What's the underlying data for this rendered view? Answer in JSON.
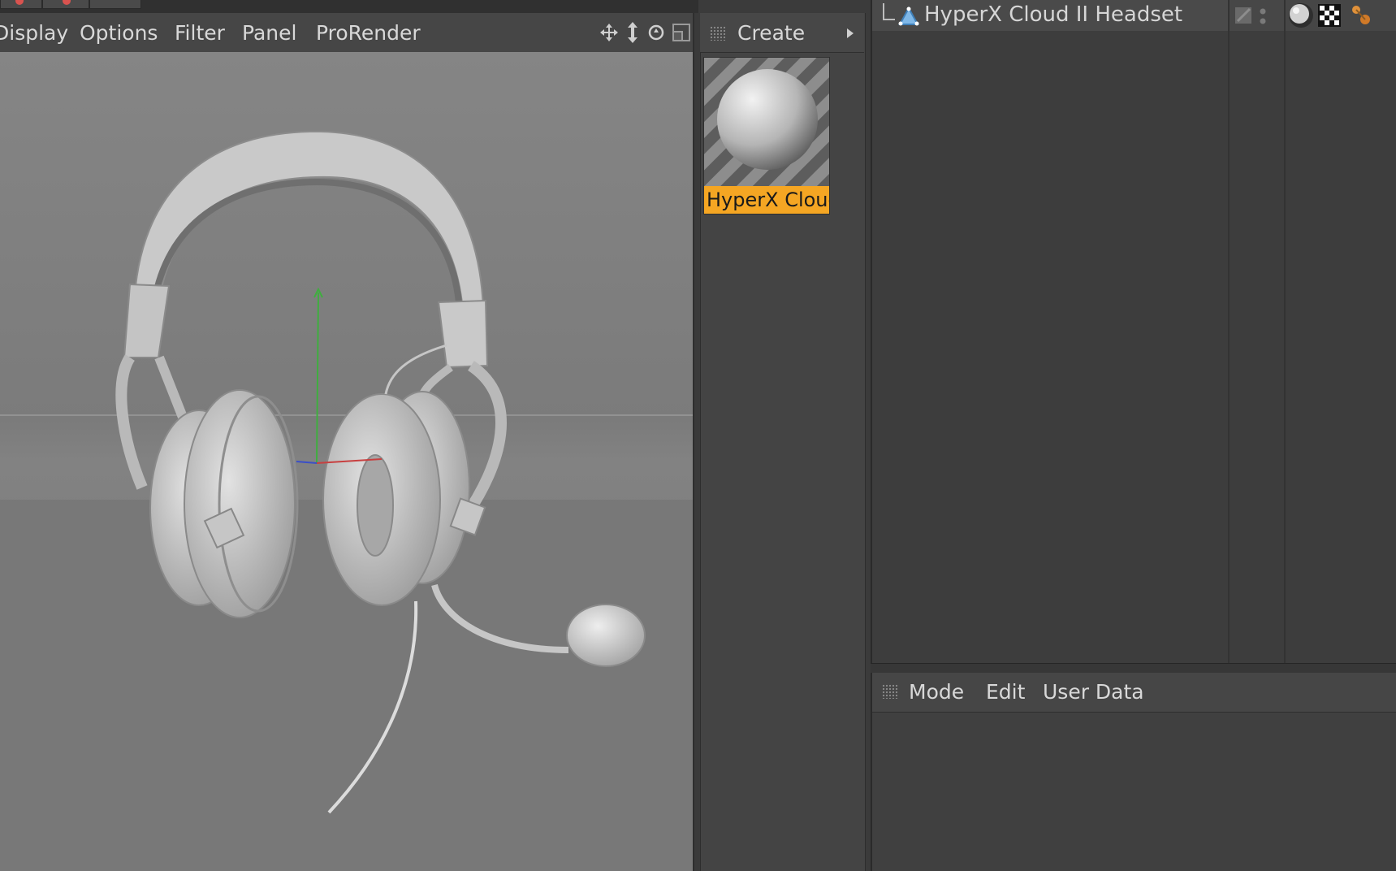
{
  "viewport_menu": {
    "items": [
      "Display",
      "Options",
      "Filter",
      "Panel",
      "ProRender"
    ],
    "nav_icons": [
      "move-view-icon",
      "zoom-view-icon",
      "rotate-view-icon",
      "toggle-layout-icon"
    ]
  },
  "material_manager": {
    "menu_label": "Create",
    "material_name": "HyperX Cloud"
  },
  "object_manager": {
    "object_name": "HyperX Cloud II Headset",
    "tags": [
      "material-sphere-tag-icon",
      "checker-texture-tag-icon",
      "orange-dots-tag-icon"
    ]
  },
  "attributes": {
    "menu": [
      "Mode",
      "Edit",
      "User Data"
    ]
  }
}
